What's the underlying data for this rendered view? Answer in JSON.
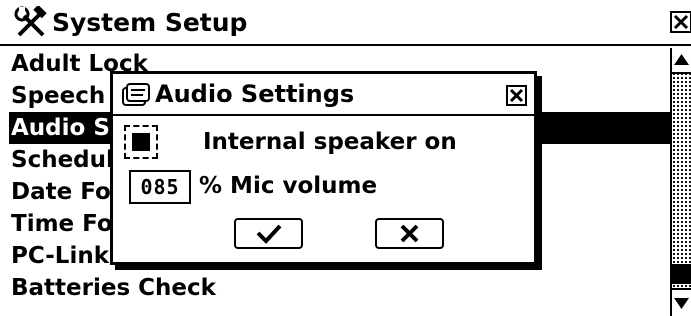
{
  "window": {
    "title": "System Setup",
    "title_icon": "tools-icon",
    "close_icon": "close-icon"
  },
  "list": {
    "items": [
      {
        "label": "Adult Lock"
      },
      {
        "label": "Speech"
      },
      {
        "label": "Audio Settings",
        "selected": true
      },
      {
        "label": "Schedule"
      },
      {
        "label": "Date Format"
      },
      {
        "label": "Time Format"
      },
      {
        "label": "PC-Link Baudrate"
      },
      {
        "label": "Batteries Check"
      }
    ]
  },
  "scrollbar": {
    "up_icon": "scroll-up-icon",
    "down_icon": "scroll-down-icon"
  },
  "dialog": {
    "title": "Audio Settings",
    "title_icon": "card-icon",
    "close_icon": "close-icon",
    "speaker": {
      "checked": true,
      "label": "Internal speaker on"
    },
    "mic": {
      "value": "085",
      "label": "% Mic volume"
    },
    "ok_icon": "checkmark-icon",
    "cancel_icon": "x-icon"
  }
}
